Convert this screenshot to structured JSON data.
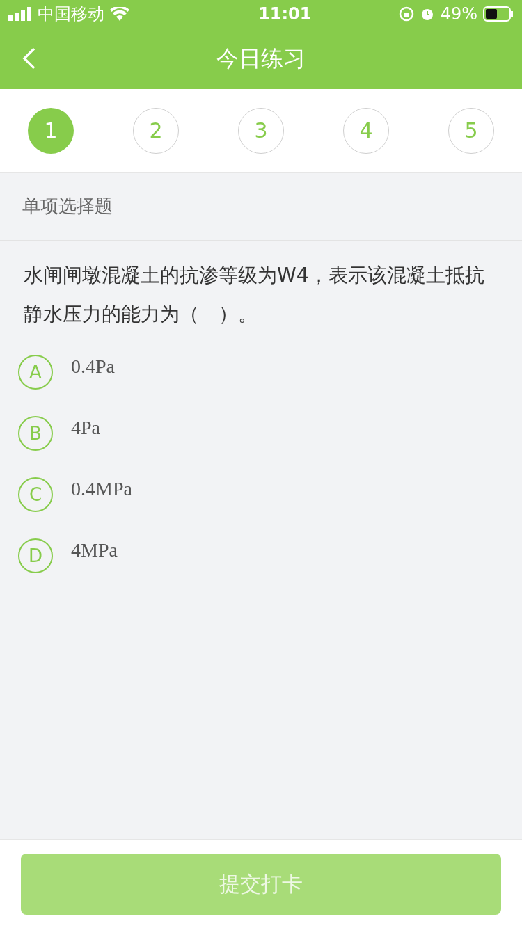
{
  "status_bar": {
    "carrier": "中国移动",
    "time": "11:01",
    "battery": "49%"
  },
  "header": {
    "title": "今日练习"
  },
  "steps": [
    {
      "label": "1",
      "selected": true
    },
    {
      "label": "2",
      "selected": false
    },
    {
      "label": "3",
      "selected": false
    },
    {
      "label": "4",
      "selected": false
    },
    {
      "label": "5",
      "selected": false
    }
  ],
  "section_title": "单项选择题",
  "question": "水闸闸墩混凝土的抗渗等级为W4，表示该混凝土抵抗静水压力的能力为（　）。",
  "options": [
    {
      "letter": "A",
      "text": "0.4Pa",
      "selected": false
    },
    {
      "letter": "B",
      "text": "4Pa",
      "selected": false
    },
    {
      "letter": "C",
      "text": "0.4MPa",
      "selected": false
    },
    {
      "letter": "D",
      "text": "4MPa",
      "selected": false
    }
  ],
  "submit": {
    "label": "提交打卡",
    "disabled": true
  }
}
